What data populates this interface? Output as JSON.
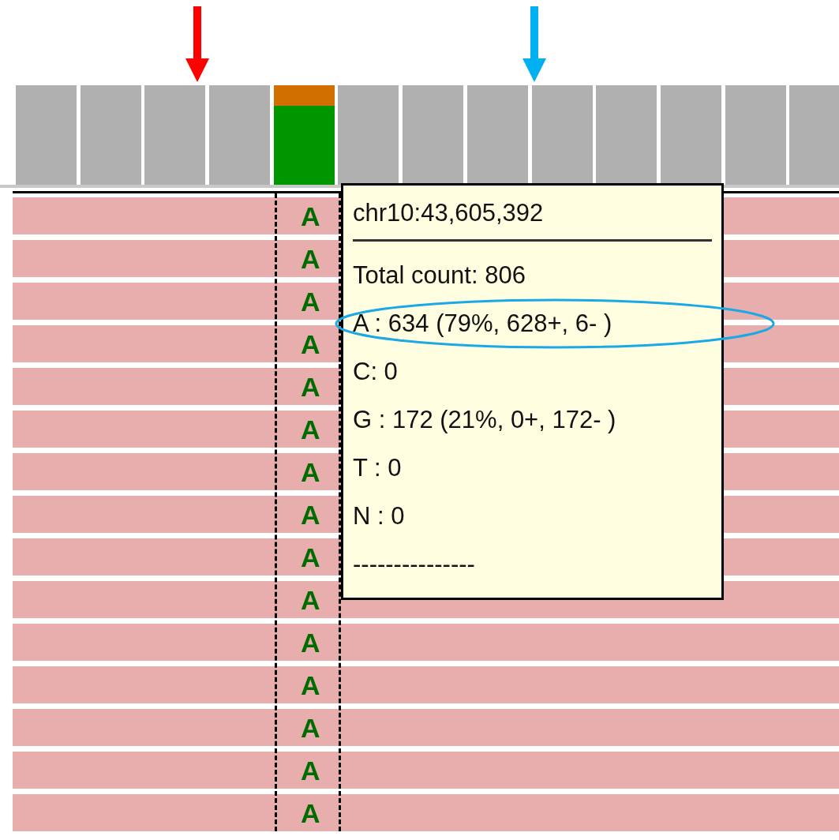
{
  "arrows": [
    {
      "kind": "arrow",
      "color": "#ff0000"
    },
    {
      "kind": "arrow",
      "color": "#00b0f0"
    }
  ],
  "coverage": [
    {
      "kind": "match"
    },
    {
      "kind": "match"
    },
    {
      "kind": "match"
    },
    {
      "kind": "match"
    },
    {
      "kind": "mismatch",
      "color": "#d17000",
      "fill": {
        "color": "#009600",
        "level": 0.79
      }
    },
    {
      "kind": "match"
    },
    {
      "kind": "match"
    },
    {
      "kind": "match"
    },
    {
      "kind": "match"
    },
    {
      "kind": "match"
    },
    {
      "kind": "match"
    },
    {
      "kind": "match"
    },
    {
      "kind": "match"
    }
  ],
  "reads": [
    {
      "base": "A"
    },
    {
      "base": "A"
    },
    {
      "base": "A"
    },
    {
      "base": "A"
    },
    {
      "base": "A"
    },
    {
      "base": "A"
    },
    {
      "base": "A"
    },
    {
      "base": "A"
    },
    {
      "base": "A"
    },
    {
      "base": "A"
    },
    {
      "base": "A"
    },
    {
      "base": "A"
    },
    {
      "base": "A"
    },
    {
      "base": "A"
    },
    {
      "base": "A"
    }
  ],
  "tooltip": {
    "lines": [
      {
        "kind": "text",
        "text": "chr10:43,605,392",
        "highlighted": false
      },
      {
        "kind": "rule"
      },
      {
        "kind": "text",
        "text": "Total count: 806",
        "highlighted": false
      },
      {
        "kind": "text",
        "text": "A : 634 (79%, 628+, 6- )",
        "highlighted": true
      },
      {
        "kind": "text",
        "text": "C: 0",
        "highlighted": false
      },
      {
        "kind": "text",
        "text": "G : 172 (21%, 0+, 172- )",
        "highlighted": false
      },
      {
        "kind": "text",
        "text": "T : 0",
        "highlighted": false
      },
      {
        "kind": "text",
        "text": "N : 0",
        "highlighted": false
      },
      {
        "kind": "text",
        "text": "---------------",
        "highlighted": false
      }
    ]
  }
}
